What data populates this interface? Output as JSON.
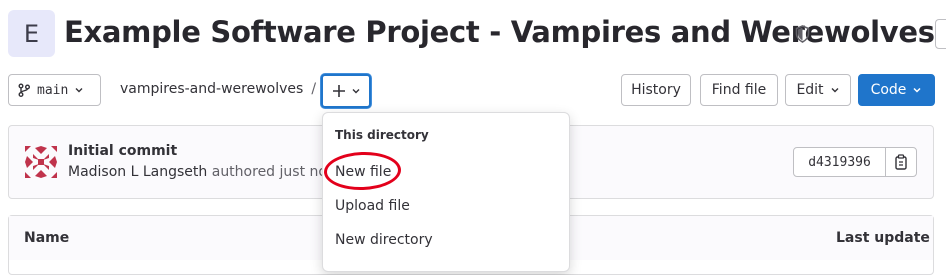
{
  "project": {
    "avatar_letter": "E",
    "title": "Example Software Project - Vampires and Werewolves"
  },
  "toolbar": {
    "branch": "main",
    "path_repo": "vampires-and-werewolves",
    "path_separator": "/",
    "history_label": "History",
    "find_file_label": "Find file",
    "edit_label": "Edit",
    "code_label": "Code",
    "accent_color": "#1f75cb"
  },
  "commit": {
    "title": "Initial commit",
    "author": "Madison L Langseth",
    "action": "authored just now",
    "sha": "d4319396"
  },
  "file_table": {
    "columns": [
      "Name",
      "Last update"
    ]
  },
  "dropdown": {
    "header": "This directory",
    "items": [
      "New file",
      "Upload file",
      "New directory"
    ],
    "highlight_color": "#e3001b"
  }
}
